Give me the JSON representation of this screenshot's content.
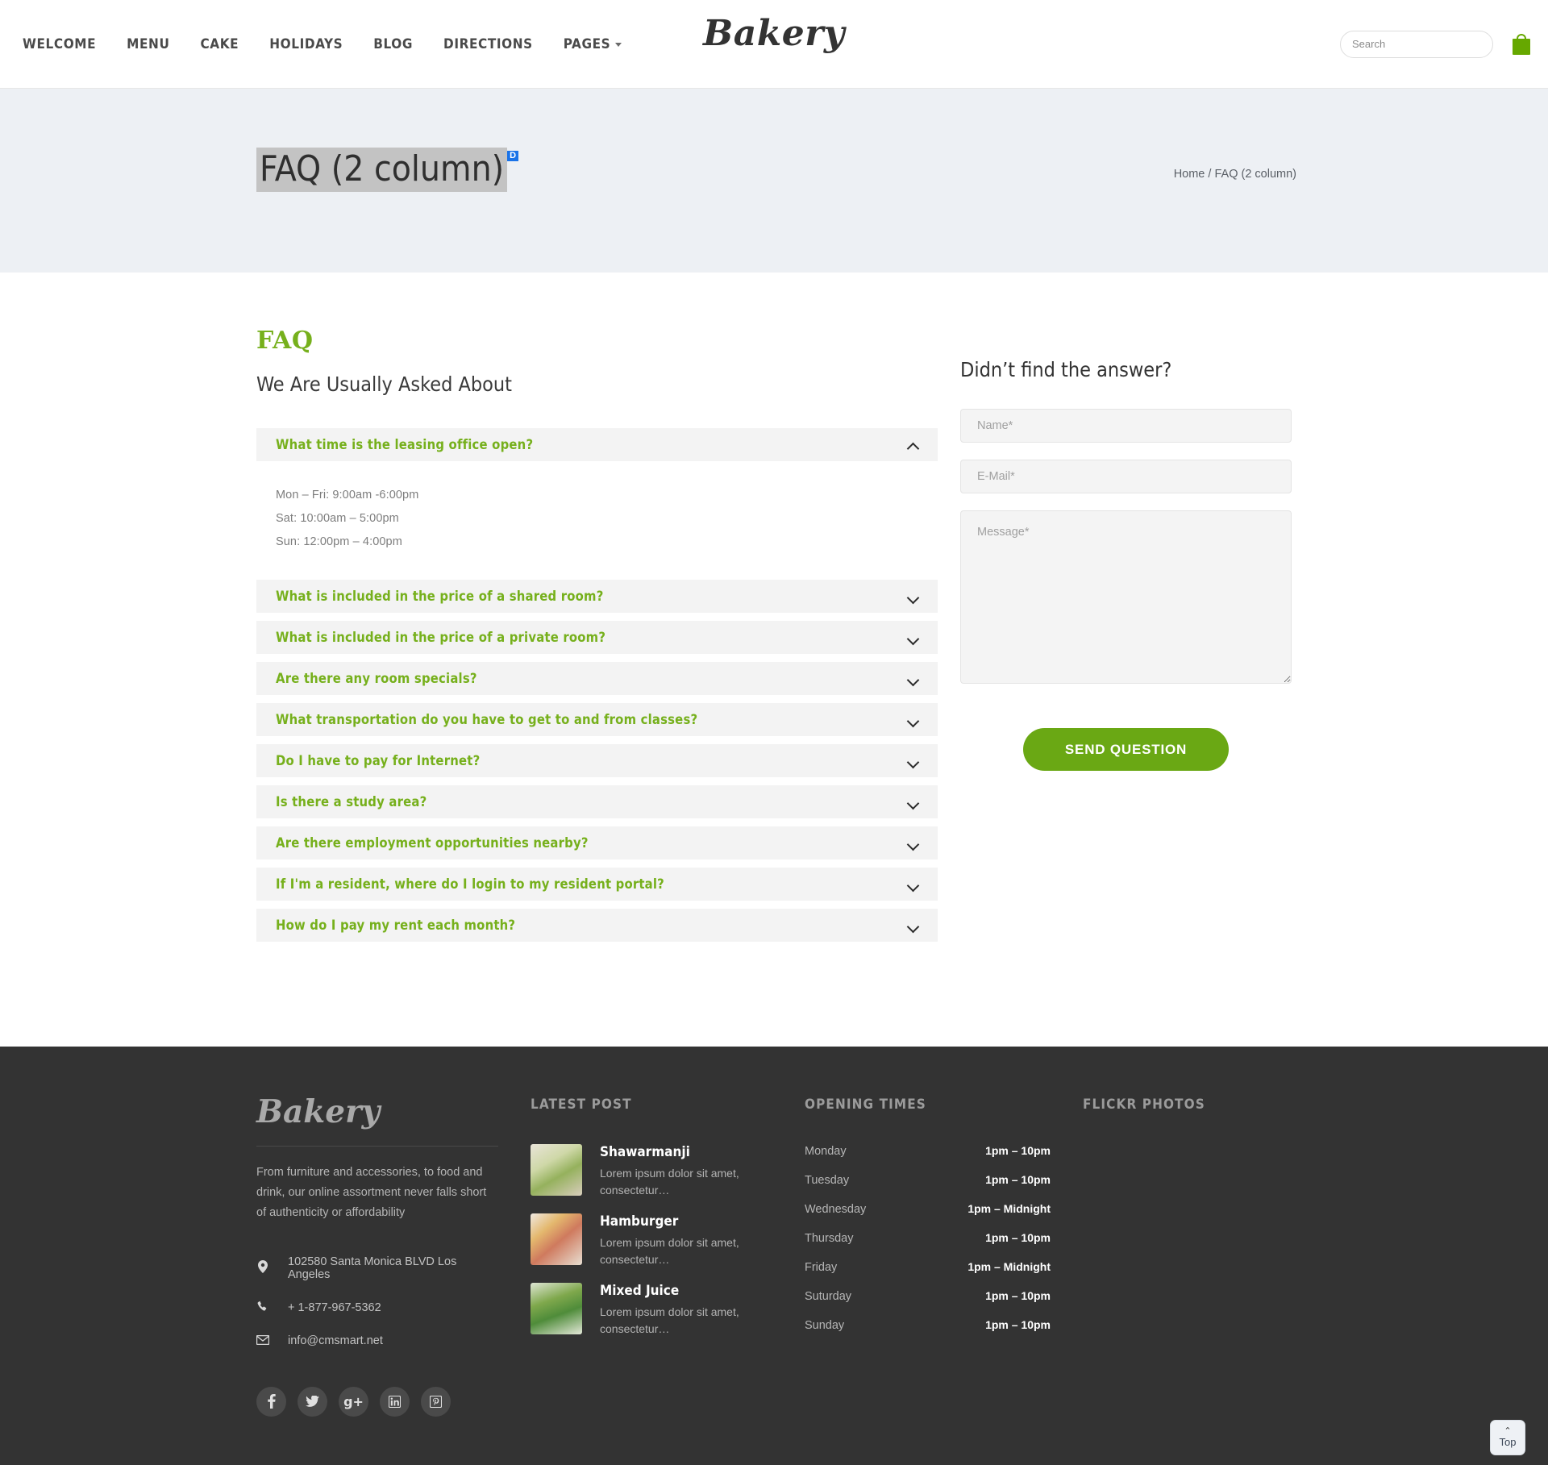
{
  "header": {
    "nav": [
      {
        "label": "WELCOME",
        "has_caret": false
      },
      {
        "label": "MENU",
        "has_caret": false
      },
      {
        "label": "CAKE",
        "has_caret": false
      },
      {
        "label": "HOLIDAYS",
        "has_caret": false
      },
      {
        "label": "BLOG",
        "has_caret": false
      },
      {
        "label": "DIRECTIONS",
        "has_caret": false
      },
      {
        "label": "PAGES",
        "has_caret": true
      }
    ],
    "logo": "Bakery",
    "search_placeholder": "Search",
    "search_value": "",
    "cart_icon": "shopping-bag-icon",
    "cart_color": "#66a800"
  },
  "banner": {
    "title": "FAQ (2 column)",
    "selection_badge": "D",
    "breadcrumb_home": "Home",
    "breadcrumb_sep": "/",
    "breadcrumb_current": "FAQ (2 column)"
  },
  "faq": {
    "kicker": "FAQ",
    "subtitle": "We Are Usually Asked About",
    "items": [
      {
        "question": "What time is the leasing office open?",
        "expanded": true,
        "answer_lines": [
          "Mon – Fri: 9:00am  -6:00pm",
          "Sat: 10:00am – 5:00pm",
          "Sun: 12:00pm – 4:00pm"
        ]
      },
      {
        "question": "What is included in the price of a shared room?",
        "expanded": false,
        "answer_lines": []
      },
      {
        "question": "What is included in the price of a private room?",
        "expanded": false,
        "answer_lines": []
      },
      {
        "question": "Are there any room specials?",
        "expanded": false,
        "answer_lines": []
      },
      {
        "question": "What transportation do you have to get to and from classes?",
        "expanded": false,
        "answer_lines": []
      },
      {
        "question": "Do I have to pay for Internet?",
        "expanded": false,
        "answer_lines": []
      },
      {
        "question": "Is there a study area?",
        "expanded": false,
        "answer_lines": []
      },
      {
        "question": "Are there employment opportunities nearby?",
        "expanded": false,
        "answer_lines": []
      },
      {
        "question": "If I'm a resident, where do I login to my resident portal?",
        "expanded": false,
        "answer_lines": []
      },
      {
        "question": "How do I pay my rent each month?",
        "expanded": false,
        "answer_lines": []
      }
    ]
  },
  "contact_form": {
    "title": "Didn’t find the answer?",
    "name_placeholder": "Name*",
    "name_value": "",
    "email_placeholder": "E-Mail*",
    "email_value": "",
    "message_placeholder": "Message*",
    "message_value": "",
    "submit_label": "SEND QUESTION",
    "submit_color": "#6aa814"
  },
  "footer": {
    "logo": "Bakery",
    "description": "From furniture and accessories, to food and drink, our online assortment never falls short of authenticity or affordability",
    "contacts": [
      {
        "icon": "map-pin-icon",
        "text": "102580 Santa Monica BLVD Los Angeles"
      },
      {
        "icon": "phone-icon",
        "text": "+ 1-877-967-5362"
      },
      {
        "icon": "envelope-icon",
        "text": "info@cmsmart.net"
      }
    ],
    "latest_post": {
      "heading": "LATEST POST",
      "posts": [
        {
          "title": "Shawarmanji",
          "excerpt": "Lorem ipsum dolor sit amet, consectetur…"
        },
        {
          "title": "Hamburger",
          "excerpt": "Lorem ipsum dolor sit amet, consectetur…"
        },
        {
          "title": "Mixed Juice",
          "excerpt": "Lorem ipsum dolor sit amet, consectetur…"
        }
      ]
    },
    "opening_times": {
      "heading": "OPENING TIMES",
      "rows": [
        {
          "day": "Monday",
          "time": "1pm – 10pm"
        },
        {
          "day": "Tuesday",
          "time": "1pm – 10pm"
        },
        {
          "day": "Wednesday",
          "time": "1pm – Midnight"
        },
        {
          "day": "Thursday",
          "time": "1pm – 10pm"
        },
        {
          "day": "Friday",
          "time": "1pm – Midnight"
        },
        {
          "day": "Suturday",
          "time": "1pm – 10pm"
        },
        {
          "day": "Sunday",
          "time": "1pm – 10pm"
        }
      ]
    },
    "flickr": {
      "heading": "FLICKR PHOTOS"
    },
    "socials": [
      {
        "name": "facebook-icon",
        "glyph": "f"
      },
      {
        "name": "twitter-icon",
        "glyph": "🐦"
      },
      {
        "name": "google-plus-icon",
        "glyph": "g+"
      },
      {
        "name": "linkedin-icon",
        "glyph": "in"
      },
      {
        "name": "pinterest-icon",
        "glyph": "p"
      }
    ]
  },
  "to_top": {
    "caret": "⌃",
    "label": "Top"
  }
}
